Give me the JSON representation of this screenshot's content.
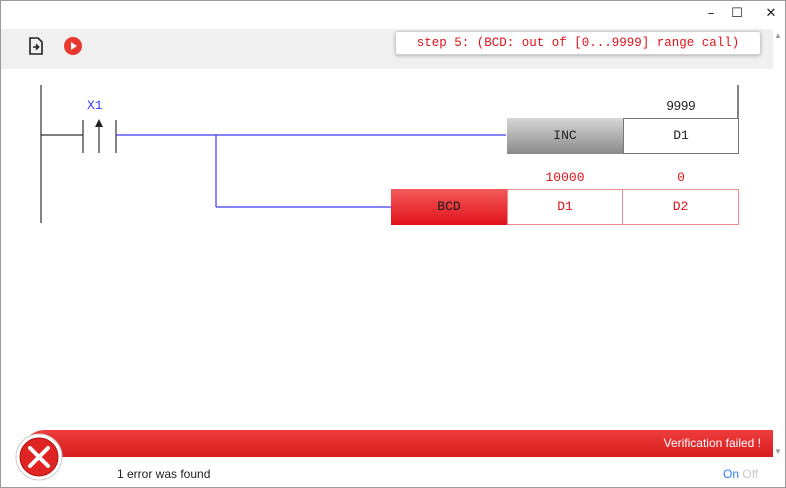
{
  "window": {
    "minimize_glyph": "–",
    "maximize_glyph": "☐",
    "close_glyph": "✕"
  },
  "toolbar": {
    "icons": [
      "export-icon",
      "run-icon"
    ],
    "step_message": "step 5: (BCD: out of [0...9999] range call)"
  },
  "ladder": {
    "contact": {
      "label": "X1",
      "type": "rising-edge"
    },
    "rung1": {
      "instruction": "INC",
      "operand": "D1",
      "operand_value": "9999"
    },
    "rung2": {
      "instruction": "BCD",
      "operands": [
        "D1",
        "D2"
      ],
      "operand_values": [
        "10000",
        "0"
      ]
    }
  },
  "status": {
    "verification": "Verification failed !",
    "error_count_text": "1 error was found",
    "on_label": "On",
    "off_label": "Off"
  },
  "colors": {
    "error_red": "#e0121b",
    "wire_blue": "#3a3af0",
    "link_blue": "#2c7cff"
  }
}
